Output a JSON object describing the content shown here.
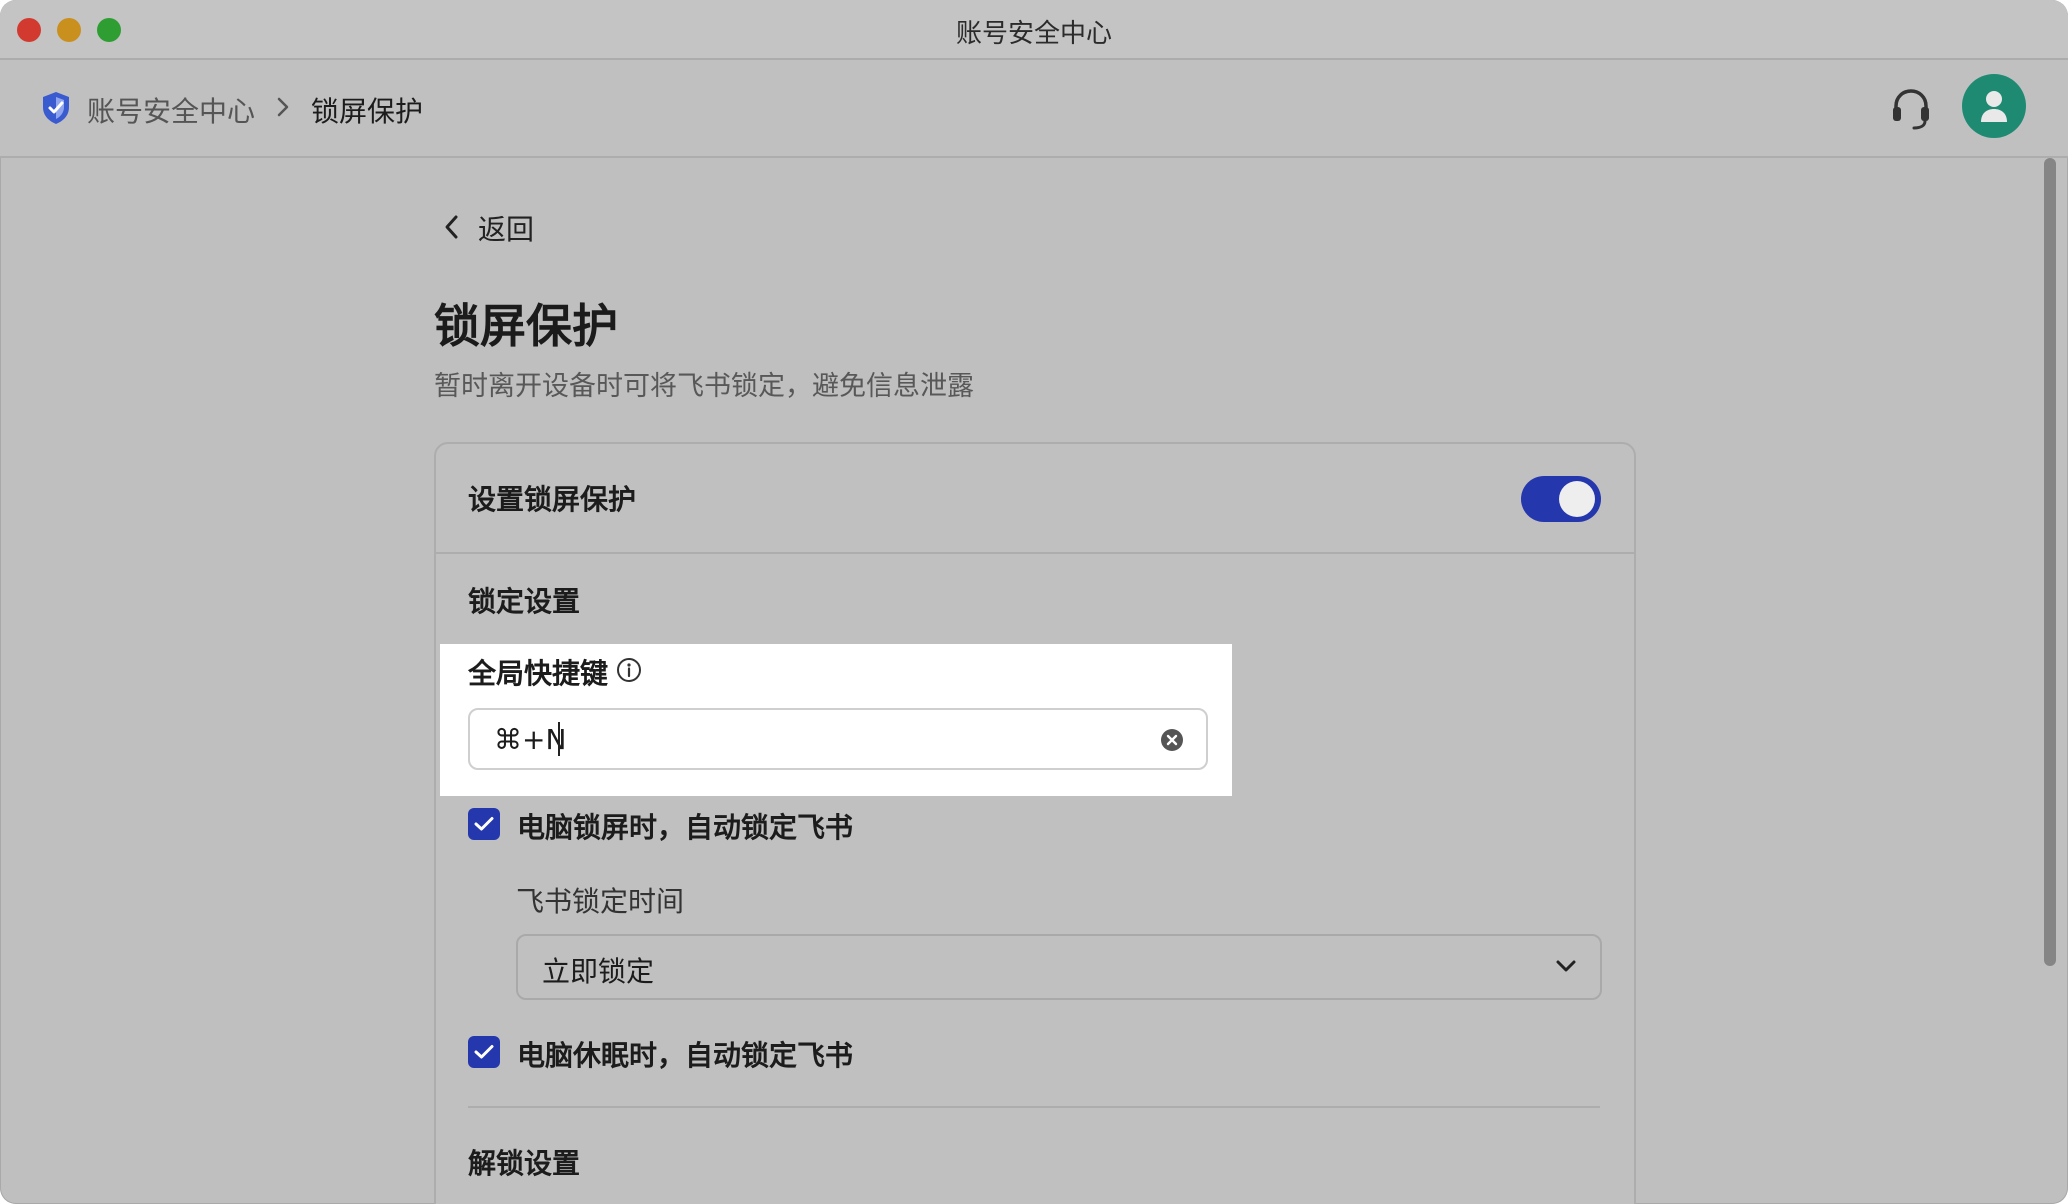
{
  "window": {
    "title": "账号安全中心"
  },
  "header": {
    "breadcrumb": {
      "root": "账号安全中心",
      "current": "锁屏保护"
    }
  },
  "page": {
    "back_label": "返回",
    "title": "锁屏保护",
    "description": "暂时离开设备时可将飞书锁定，避免信息泄露"
  },
  "card": {
    "lock_protection": {
      "label": "设置锁屏保护",
      "enabled": true
    },
    "lock_settings": {
      "heading": "锁定设置",
      "shortcut": {
        "label": "全局快捷键",
        "value": "⌘+N"
      },
      "lock_on_screen_lock": {
        "label": "电脑锁屏时，自动锁定飞书",
        "checked": true
      },
      "lock_time": {
        "label": "飞书锁定时间",
        "selected": "立即锁定"
      },
      "lock_on_sleep": {
        "label": "电脑休眠时，自动锁定飞书",
        "checked": true
      }
    },
    "unlock_settings": {
      "heading": "解锁设置"
    }
  },
  "colors": {
    "accent": "#2537ad",
    "avatar": "#1f8a72",
    "shield": "#3a5bd0"
  }
}
